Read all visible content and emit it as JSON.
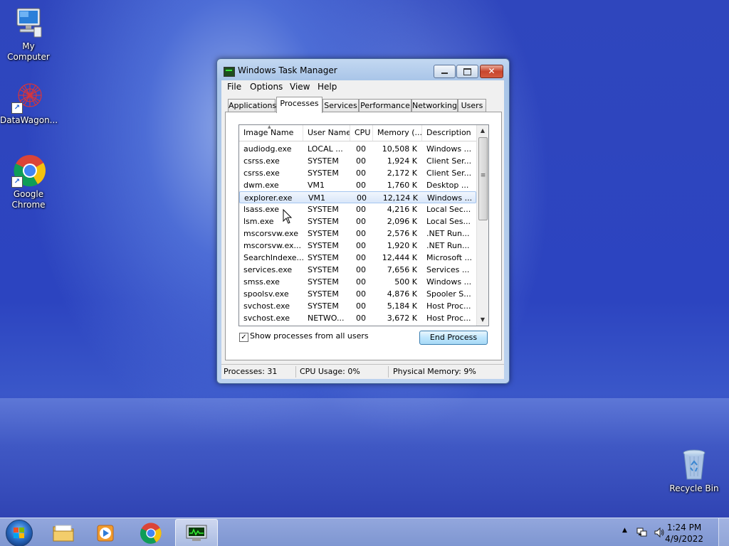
{
  "desktop": {
    "icons": [
      {
        "label": "My Computer"
      },
      {
        "label": "DataWagon..."
      },
      {
        "label": "Google\nChrome"
      },
      {
        "label": "Recycle Bin"
      }
    ]
  },
  "window": {
    "title": "Windows Task Manager",
    "close_glyph": "✕",
    "menu": [
      "File",
      "Options",
      "View",
      "Help"
    ],
    "tabs": [
      "Applications",
      "Processes",
      "Services",
      "Performance",
      "Networking",
      "Users"
    ],
    "active_tab": "Processes",
    "columns": [
      "Image Name",
      "User Name",
      "CPU",
      "Memory (...",
      "Description"
    ],
    "sort_glyph": "▲",
    "rows": [
      {
        "name": "audiodg.exe",
        "user": "LOCAL ...",
        "cpu": "00",
        "mem": "10,508 K",
        "desc": "Windows ..."
      },
      {
        "name": "csrss.exe",
        "user": "SYSTEM",
        "cpu": "00",
        "mem": "1,924 K",
        "desc": "Client Ser..."
      },
      {
        "name": "csrss.exe",
        "user": "SYSTEM",
        "cpu": "00",
        "mem": "2,172 K",
        "desc": "Client Ser..."
      },
      {
        "name": "dwm.exe",
        "user": "VM1",
        "cpu": "00",
        "mem": "1,760 K",
        "desc": "Desktop ..."
      },
      {
        "name": "explorer.exe",
        "user": "VM1",
        "cpu": "00",
        "mem": "12,124 K",
        "desc": "Windows ...",
        "selected": true
      },
      {
        "name": "lsass.exe",
        "user": "SYSTEM",
        "cpu": "00",
        "mem": "4,216 K",
        "desc": "Local Sec..."
      },
      {
        "name": "lsm.exe",
        "user": "SYSTEM",
        "cpu": "00",
        "mem": "2,096 K",
        "desc": "Local Ses..."
      },
      {
        "name": "mscorsvw.exe",
        "user": "SYSTEM",
        "cpu": "00",
        "mem": "2,576 K",
        "desc": ".NET Run..."
      },
      {
        "name": "mscorsvw.ex...",
        "user": "SYSTEM",
        "cpu": "00",
        "mem": "1,920 K",
        "desc": ".NET Run..."
      },
      {
        "name": "SearchIndexe...",
        "user": "SYSTEM",
        "cpu": "00",
        "mem": "12,444 K",
        "desc": "Microsoft ..."
      },
      {
        "name": "services.exe",
        "user": "SYSTEM",
        "cpu": "00",
        "mem": "7,656 K",
        "desc": "Services ..."
      },
      {
        "name": "smss.exe",
        "user": "SYSTEM",
        "cpu": "00",
        "mem": "500 K",
        "desc": "Windows ..."
      },
      {
        "name": "spoolsv.exe",
        "user": "SYSTEM",
        "cpu": "00",
        "mem": "4,876 K",
        "desc": "Spooler S..."
      },
      {
        "name": "svchost.exe",
        "user": "SYSTEM",
        "cpu": "00",
        "mem": "5,184 K",
        "desc": "Host Proc..."
      },
      {
        "name": "svchost.exe",
        "user": "NETWO...",
        "cpu": "00",
        "mem": "3,672 K",
        "desc": "Host Proc..."
      }
    ],
    "show_all_users_label": "Show processes from all users",
    "show_all_users_checked": true,
    "check_glyph": "✓",
    "end_process_label": "End Process",
    "status": {
      "processes": "Processes: 31",
      "cpu": "CPU Usage: 0%",
      "memory": "Physical Memory: 9%"
    }
  },
  "taskbar": {
    "pinned": [
      "explorer-folder-icon",
      "media-player-icon",
      "chrome-icon",
      "task-manager-icon"
    ],
    "clock_time": "1:24 PM",
    "clock_date": "4/9/2022",
    "tray_arrow": "▲"
  }
}
